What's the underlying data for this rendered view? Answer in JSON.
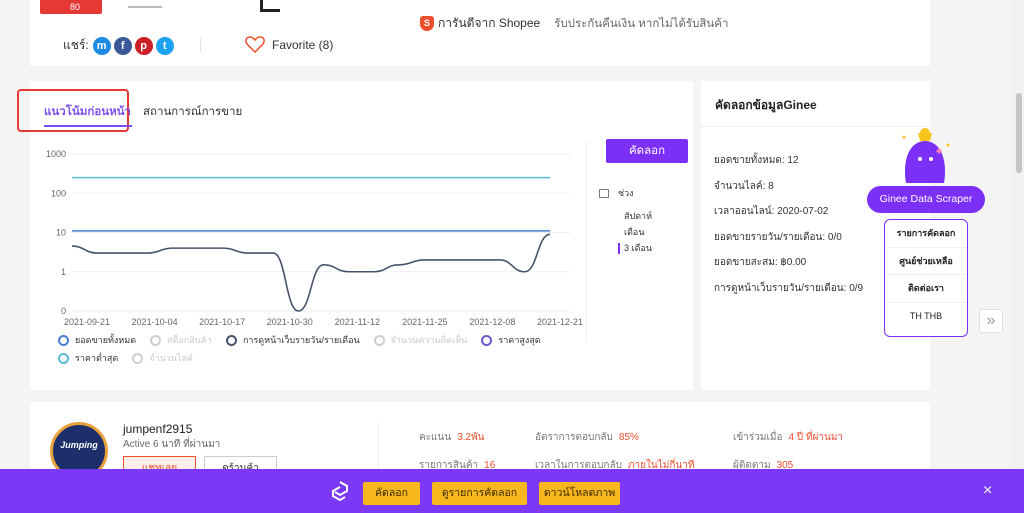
{
  "product": {
    "thumb_badge": "80"
  },
  "guarantee": {
    "icon_letter": "S",
    "title": "การันตีจาก Shopee",
    "description": "รับประกันคืนเงิน หากไม่ได้รับสินค้า"
  },
  "share": {
    "label": "แชร์:",
    "icons": [
      "messenger-icon",
      "facebook-icon",
      "pinterest-icon",
      "twitter-icon"
    ],
    "colors": {
      "messenger": "#1e88e5",
      "facebook": "#3b5998",
      "pinterest": "#cb2027",
      "twitter": "#1da1f2"
    },
    "glyphs": {
      "messenger": "m",
      "facebook": "f",
      "pinterest": "p",
      "twitter": "t"
    }
  },
  "favorite": {
    "label": "Favorite (8)",
    "color": "#ee4d2d"
  },
  "tabs": {
    "trend": "แนวโน้มก่อนหน้า",
    "status": "สถานการณ์การขาย"
  },
  "chart_panel": {
    "copy_button": "คัดลอก",
    "period_label": "ช่วง",
    "period_options": [
      "สัปดาห์",
      "เดือน",
      "3 เดือน"
    ],
    "period_active_index": 2
  },
  "chart_data": {
    "type": "line",
    "y_scale": "log",
    "y_ticks": [
      "1000",
      "100",
      "10",
      "1",
      "0"
    ],
    "x_ticks": [
      "2021-09-21",
      "2021-10-04",
      "2021-10-17",
      "2021-10-30",
      "2021-11-12",
      "2021-11-25",
      "2021-12-08",
      "2021-12-21"
    ],
    "grid": true,
    "series": [
      {
        "name": "ราคาสูงสุด",
        "color": "#59b8d6",
        "values": [
          250,
          250,
          250,
          250,
          250,
          250,
          250,
          250,
          250,
          250,
          250,
          250,
          250,
          250,
          250,
          250,
          250,
          250,
          250,
          250
        ]
      },
      {
        "name": "ราคาต่ำสุด",
        "color": "#4a7fd4",
        "values": [
          11,
          11,
          11,
          11,
          11,
          11,
          11,
          11,
          11,
          11,
          11,
          11,
          11,
          11,
          11,
          11,
          11,
          11,
          11,
          11
        ]
      },
      {
        "name": "การดูหน้าเว็บรายวัน/รายเดือน",
        "color": "#46546b",
        "values": [
          4.5,
          3,
          3,
          3,
          4,
          4,
          4,
          3,
          3,
          0,
          1.5,
          1,
          1,
          1.5,
          2,
          2,
          2,
          2,
          1,
          9
        ]
      }
    ],
    "legend": [
      {
        "label": "ยอดขายทั้งหมด",
        "color": "#4a7fd4",
        "enabled": true
      },
      {
        "label": "สต็อกสินค้า",
        "color": "#cfcfcf",
        "enabled": false
      },
      {
        "label": "การดูหน้าเว็บรายวัน/รายเดือน",
        "color": "#46546b",
        "enabled": true
      },
      {
        "label": "จำนวนความคิดเห็น",
        "color": "#cfcfcf",
        "enabled": false
      },
      {
        "label": "ราคาสูงสุด",
        "color": "#6a5acd",
        "enabled": true
      },
      {
        "label": "ราคาต่ำสุด",
        "color": "#59b8d6",
        "enabled": true
      },
      {
        "label": "จำนวนไลค์",
        "color": "#cfcfcf",
        "enabled": false
      }
    ]
  },
  "ginee": {
    "title": "คัดลอกข้อมูลGinee",
    "stats": [
      "ยอดขายทั้งหมด: 12",
      "จำนวนไลค์: 8",
      "เวลาออนไลน์: 2020-07-02",
      "ยอดขายรายวัน/รายเดือน: 0/0",
      "ยอดขายสะสม: ฿0.00",
      "การดูหน้าเว็บรายวัน/รายเดือน: 0/9"
    ]
  },
  "scraper": {
    "button": "Ginee Data Scraper",
    "menu": [
      "รายการคัดลอก",
      "ศูนย์ช่วยเหลือ",
      "ติดต่อเรา",
      "TH   THB"
    ]
  },
  "shop": {
    "avatar_text": "Jumping",
    "name": "jumpenf2915",
    "active": "Active 6 นาที ที่ผ่านมา",
    "chat_button": "แชทเลย",
    "view_button": "ดูร้านค้า",
    "stats": [
      {
        "label": "คะแนน",
        "value": "3.2พัน"
      },
      {
        "label": "อัตราการตอบกลับ",
        "value": "85%"
      },
      {
        "label": "เข้าร่วมเมื่อ",
        "value": "4 ปี ที่ผ่านมา"
      },
      {
        "label": "รายการสินค้า",
        "value": "16"
      },
      {
        "label": "เวลาในการตอบกลับ",
        "value": "ภายในไม่กี่นาที"
      },
      {
        "label": "ผู้ติดตาม",
        "value": "305"
      }
    ]
  },
  "bottom_bar": {
    "copy": "คัดลอก",
    "list": "ดูรายการคัดลอก",
    "download": "ดาวน์โหลดภาพ",
    "close": "×"
  }
}
